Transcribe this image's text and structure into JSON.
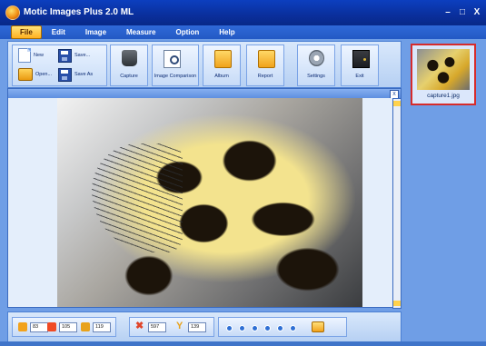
{
  "window": {
    "title": "Motic Images Plus 2.0 ML",
    "controls": [
      "–",
      "□",
      "X"
    ]
  },
  "menu": {
    "items": [
      "File",
      "Edit",
      "Image",
      "Measure",
      "Option",
      "Help"
    ],
    "active": "File"
  },
  "toolbar": {
    "new": "New",
    "save": "Save...",
    "open": "Open...",
    "save_as": "Save As",
    "capture": "Capture",
    "image_comparison": "Image Comparison",
    "album": "Album",
    "report": "Report",
    "settings": "Settings",
    "exit": "Exit"
  },
  "thumbnail": {
    "label": "capture1.jpg"
  },
  "viewer": {
    "close_icon": "x"
  },
  "bottom": {
    "r": "83",
    "g": "105",
    "b": "119",
    "x": "597",
    "y": "139",
    "icon_names": [
      "r-chip",
      "g-chip",
      "b-chip",
      "x-tool",
      "y-tool",
      "zoom-tools"
    ]
  }
}
